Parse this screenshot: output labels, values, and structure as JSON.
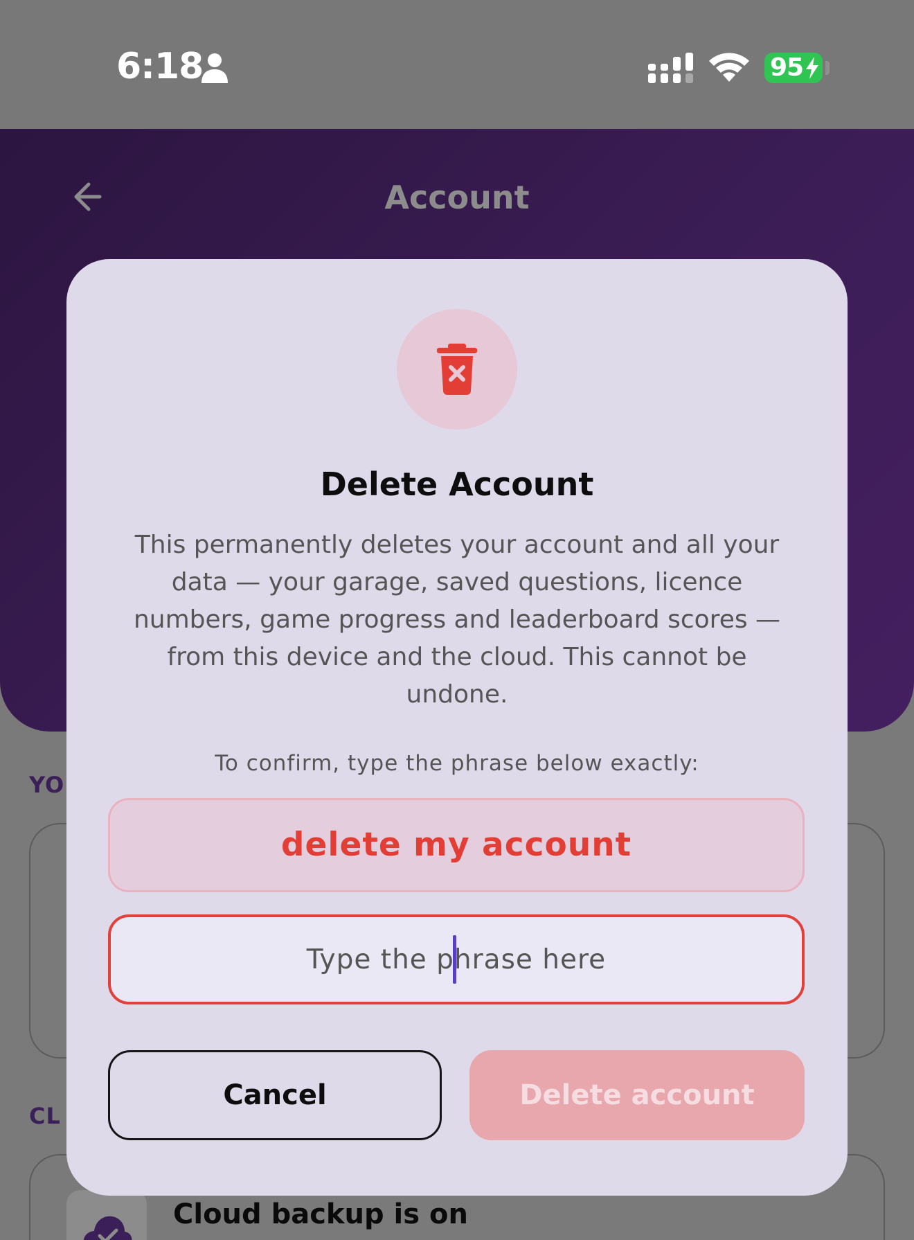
{
  "status_bar": {
    "time": "6:18",
    "battery_level": "95"
  },
  "header": {
    "title": "Account"
  },
  "background": {
    "section_1_label": "YO",
    "section_2_label": "CL",
    "cloud_backup_title": "Cloud backup is on"
  },
  "dialog": {
    "title": "Delete Account",
    "body": "This permanently deletes your account and all your data — your garage, saved questions, licence numbers, game progress and leaderboard scores — from this device and the cloud. This cannot be undone.",
    "confirm_hint": "To confirm, type the phrase below exactly:",
    "phrase": "delete my account",
    "input_placeholder": "Type the phrase here",
    "input_value": "",
    "cancel_label": "Cancel",
    "delete_label": "Delete account"
  },
  "colors": {
    "danger": "#e33e35",
    "header_purple": "#3b1d55",
    "battery_green": "#30c552"
  },
  "icons": {
    "back": "arrow-left-icon",
    "trash": "trash-x-icon",
    "cloud": "cloud-check-icon"
  }
}
